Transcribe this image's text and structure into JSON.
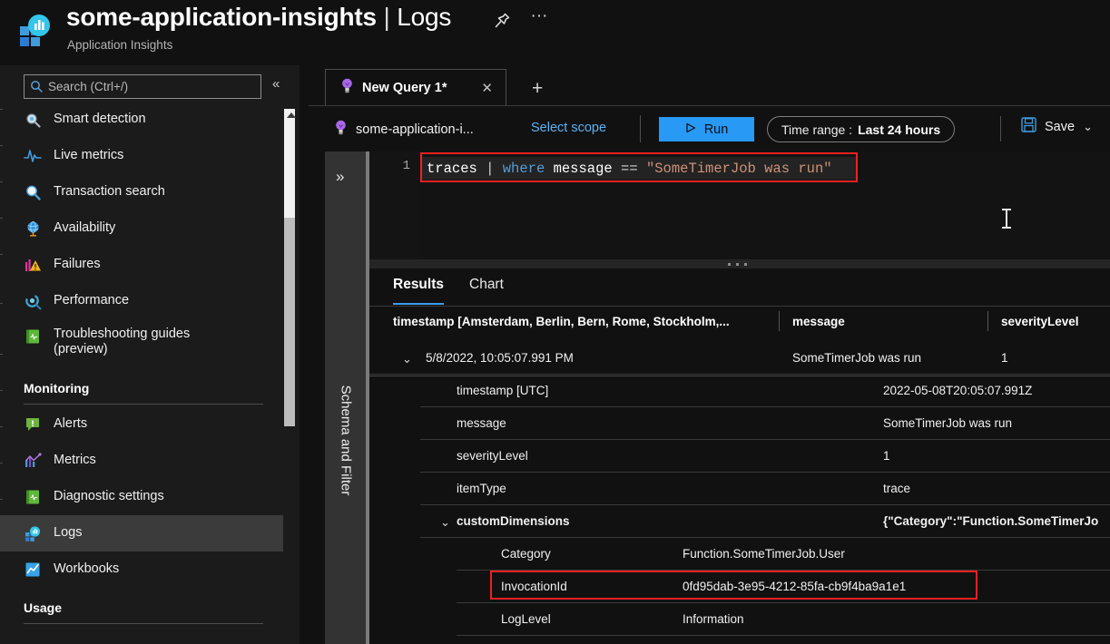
{
  "header": {
    "resource_name": "some-application-insights",
    "separator": "|",
    "page": "Logs",
    "subtitle": "Application Insights",
    "pin_icon": "pin-icon",
    "more_icon": "ellipsis-icon"
  },
  "sidebar": {
    "search_placeholder": "Search (Ctrl+/)",
    "search_value": "",
    "collapse_label": "«",
    "items": [
      {
        "label": "Smart detection",
        "icon": "smart-detection-icon",
        "selected": false
      },
      {
        "label": "Live metrics",
        "icon": "live-metrics-icon",
        "selected": false
      },
      {
        "label": "Transaction search",
        "icon": "transaction-search-icon",
        "selected": false
      },
      {
        "label": "Availability",
        "icon": "availability-globe-icon",
        "selected": false
      },
      {
        "label": "Failures",
        "icon": "failures-icon",
        "selected": false
      },
      {
        "label": "Performance",
        "icon": "performance-icon",
        "selected": false
      },
      {
        "label": "Troubleshooting guides (preview)",
        "icon": "troubleshooting-guides-icon",
        "selected": false
      }
    ],
    "section_monitoring": "Monitoring",
    "monitoring_items": [
      {
        "label": "Alerts",
        "icon": "alerts-icon",
        "selected": false
      },
      {
        "label": "Metrics",
        "icon": "metrics-icon",
        "selected": false
      },
      {
        "label": "Diagnostic settings",
        "icon": "diagnostic-settings-icon",
        "selected": false
      },
      {
        "label": "Logs",
        "icon": "logs-icon",
        "selected": true
      },
      {
        "label": "Workbooks",
        "icon": "workbooks-icon",
        "selected": false
      }
    ],
    "section_usage": "Usage"
  },
  "query_tabs": {
    "tabs": [
      {
        "label": "New Query 1*",
        "icon": "lightbulb-icon",
        "close_icon": "close-icon"
      }
    ],
    "add_tab_label": "+"
  },
  "toolbar": {
    "scope_icon": "lightbulb-icon",
    "scope_name": "some-application-i...",
    "select_scope_label": "Select scope",
    "run_label": "Run",
    "run_icon": "play-icon",
    "run_color": "#2899f5",
    "time_range_label": "Time range :",
    "time_range_value": "Last 24 hours",
    "save_label": "Save",
    "save_icon": "save-disk-icon",
    "save_chevron": "⌄"
  },
  "schema_panel": {
    "label": "Schema and Filter",
    "expand_icon": "chevron-double-right-icon"
  },
  "editor": {
    "line_number": "1",
    "tokens": [
      {
        "text": "traces",
        "cls": "k-tbl"
      },
      {
        "text": " ",
        "cls": "k-eq"
      },
      {
        "text": "|",
        "cls": "k-pipe"
      },
      {
        "text": " ",
        "cls": "k-eq"
      },
      {
        "text": "where",
        "cls": "k-op"
      },
      {
        "text": " ",
        "cls": "k-eq"
      },
      {
        "text": "message",
        "cls": "k-col"
      },
      {
        "text": " ",
        "cls": "k-eq"
      },
      {
        "text": "==",
        "cls": "k-eq"
      },
      {
        "text": " ",
        "cls": "k-eq"
      },
      {
        "text": "\"SomeTimerJob was run\"",
        "cls": "k-str"
      }
    ],
    "highlight_color": "#f02020"
  },
  "results": {
    "tabs": [
      {
        "label": "Results",
        "active": true
      },
      {
        "label": "Chart",
        "active": false
      }
    ],
    "columns": [
      "timestamp [Amsterdam, Berlin, Bern, Rome, Stockholm,...",
      "message",
      "severityLevel"
    ],
    "top_row": {
      "expanded": true,
      "timestamp": "5/8/2022, 10:05:07.991 PM",
      "message": "SomeTimerJob was run",
      "severityLevel": "1"
    },
    "detail_rows": [
      {
        "key": "timestamp [UTC]",
        "value": "2022-05-08T20:05:07.991Z",
        "indent": 1,
        "expandable": false,
        "bold": false
      },
      {
        "key": "message",
        "value": "SomeTimerJob was run",
        "indent": 1,
        "expandable": false,
        "bold": false
      },
      {
        "key": "severityLevel",
        "value": "1",
        "indent": 1,
        "expandable": false,
        "bold": false
      },
      {
        "key": "itemType",
        "value": "trace",
        "indent": 1,
        "expandable": false,
        "bold": false
      },
      {
        "key": "customDimensions",
        "value": "{\"Category\":\"Function.SomeTimerJo",
        "indent": 1,
        "expandable": true,
        "bold": true
      },
      {
        "key": "Category",
        "value": "Function.SomeTimerJob.User",
        "indent": 2,
        "expandable": false,
        "bold": false
      },
      {
        "key": "InvocationId",
        "value": "0fd95dab-3e95-4212-85fa-cb9f4ba9a1e1",
        "indent": 2,
        "expandable": false,
        "bold": false
      },
      {
        "key": "LogLevel",
        "value": "Information",
        "indent": 2,
        "expandable": false,
        "bold": false
      }
    ],
    "highlight_color": "#f02020"
  }
}
